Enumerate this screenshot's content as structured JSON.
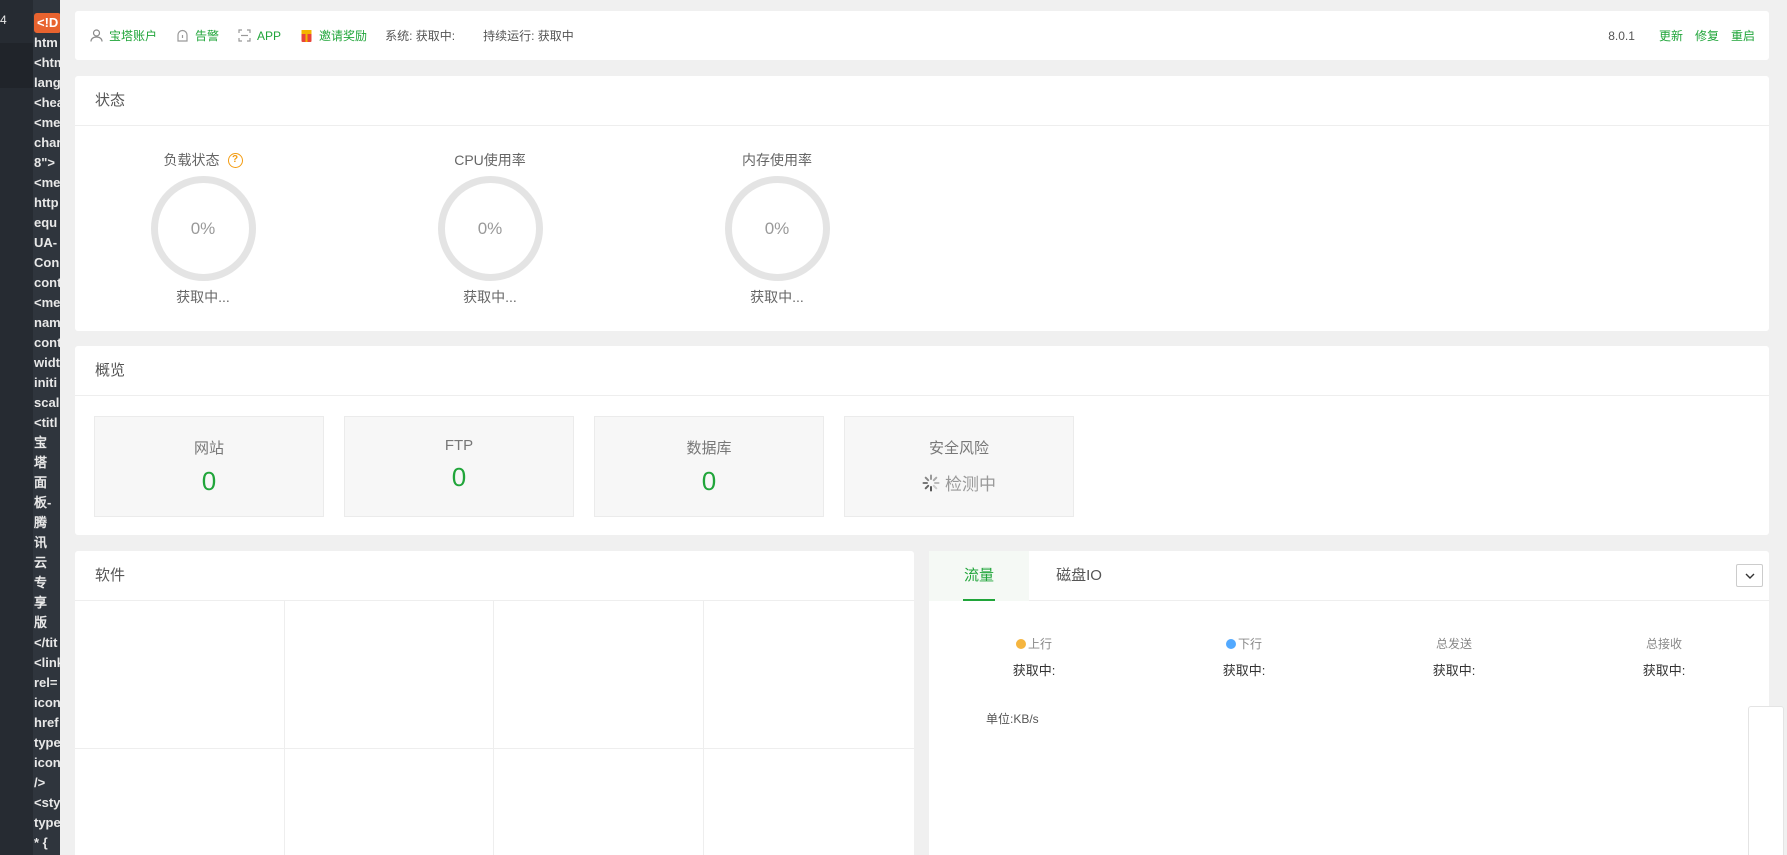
{
  "source_strip": {
    "line_number": "4",
    "lines": [
      "<!D",
      "htm",
      "<htm",
      "lang",
      "<hea",
      "<me",
      "char",
      "8\">",
      "<me",
      "http",
      "equ",
      "UA-",
      "Con",
      "cont",
      "<me",
      "nam",
      "cont",
      "widt",
      "initi",
      "scal",
      "<titl",
      "宝",
      "塔",
      "面",
      "板-",
      "腾",
      "讯",
      "云",
      "专",
      "享",
      "版",
      "</tit",
      "<link",
      "rel=",
      "icon",
      "href",
      "type",
      "icon",
      "/>",
      "<sty",
      "type",
      "* {"
    ]
  },
  "topbar": {
    "account": "宝塔账户",
    "alarm": "告警",
    "app": "APP",
    "invite": "邀请奖励",
    "system": "系统:  获取中:",
    "uptime": "持续运行: 获取中",
    "version": "8.0.1",
    "update": "更新",
    "repair": "修复",
    "restart": "重启"
  },
  "status": {
    "title": "状态",
    "gauges": [
      {
        "label": "负载状态",
        "value": "0%",
        "state": "获取中..."
      },
      {
        "label": "CPU使用率",
        "value": "0%",
        "state": "获取中..."
      },
      {
        "label": "内存使用率",
        "value": "0%",
        "state": "获取中..."
      }
    ]
  },
  "overview": {
    "title": "概览",
    "cards": [
      {
        "label": "网站",
        "value": "0"
      },
      {
        "label": "FTP",
        "value": "0"
      },
      {
        "label": "数据库",
        "value": "0"
      },
      {
        "label": "安全风险",
        "value": "检测中"
      }
    ]
  },
  "software": {
    "title": "软件"
  },
  "traffic": {
    "tabs": [
      "流量",
      "磁盘IO"
    ],
    "stats": [
      {
        "label": "上行",
        "value": "获取中:",
        "dot_color": "#f5b53f"
      },
      {
        "label": "下行",
        "value": "获取中:",
        "dot_color": "#52a9ff"
      },
      {
        "label": "总发送",
        "value": "获取中:"
      },
      {
        "label": "总接收",
        "value": "获取中:"
      }
    ],
    "unit": "单位:KB/s"
  },
  "colors": {
    "accent": "#20a53a",
    "warning": "#f39c12"
  }
}
